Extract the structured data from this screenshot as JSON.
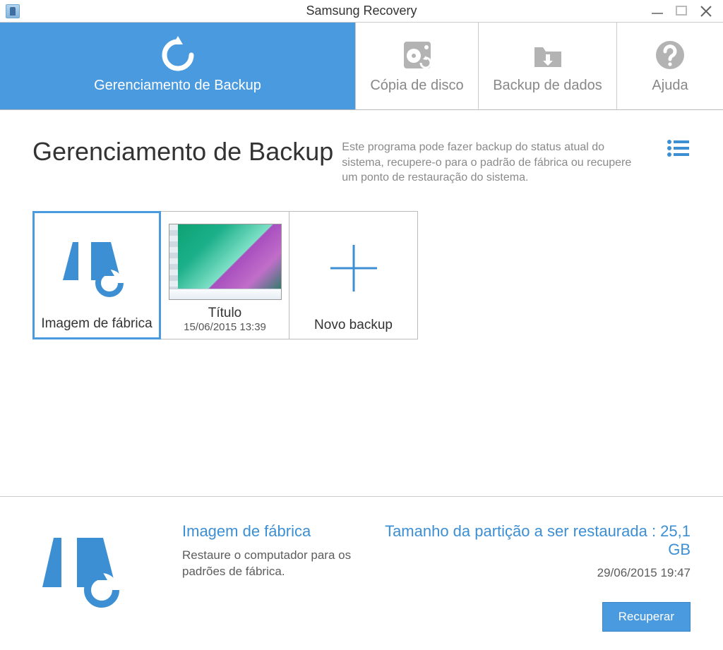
{
  "window": {
    "title": "Samsung Recovery"
  },
  "tabs": {
    "t0": "Gerenciamento de Backup",
    "t1": "Cópia de disco",
    "t2": "Backup de dados",
    "t3": "Ajuda"
  },
  "heading": "Gerenciamento de Backup",
  "description": "Este programa pode fazer backup do status atual do sistema, recupere-o para o padrão de fábrica ou recupere um ponto de restauração do sistema.",
  "cards": {
    "factory": {
      "title": "Imagem de fábrica"
    },
    "backup1": {
      "title": "Título",
      "subtitle": "15/06/2015 13:39"
    },
    "new": {
      "title": "Novo backup"
    }
  },
  "footer": {
    "title": "Imagem de fábrica",
    "desc": "Restaure o computador para os padrões de fábrica.",
    "partition": "Tamanho da partição a ser restaurada : 25,1 GB",
    "date": "29/06/2015 19:47",
    "button": "Recuperar"
  },
  "colors": {
    "accent": "#4a9ae0"
  }
}
